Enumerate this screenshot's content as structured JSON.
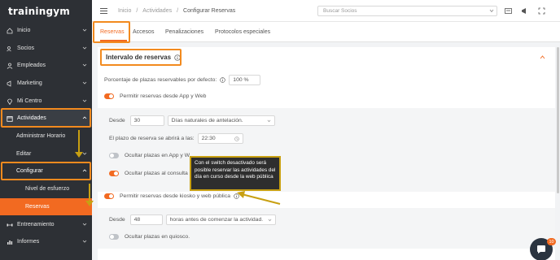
{
  "app": {
    "logo": "trainingym"
  },
  "sidebar": {
    "items": [
      {
        "label": "Inicio"
      },
      {
        "label": "Socios"
      },
      {
        "label": "Empleados"
      },
      {
        "label": "Marketing"
      },
      {
        "label": "Mi Centro"
      },
      {
        "label": "Actividades"
      },
      {
        "label": "Administrar Horario"
      },
      {
        "label": "Editar"
      },
      {
        "label": "Configurar"
      },
      {
        "label": "Nivel de esfuerzo"
      },
      {
        "label": "Reservas"
      },
      {
        "label": "Entrenamiento"
      },
      {
        "label": "Informes"
      }
    ]
  },
  "header": {
    "breadcrumb": [
      "Inicio",
      "/",
      "Actividades",
      "/",
      "Configurar Reservas"
    ],
    "search_placeholder": "Buscar Socios"
  },
  "tabs": [
    {
      "label": "Reservas"
    },
    {
      "label": "Accesos"
    },
    {
      "label": "Penalizaciones"
    },
    {
      "label": "Protocolos especiales"
    }
  ],
  "section": {
    "title": "Intervalo de reservas",
    "pct_label": "Porcentaje de plazas reservables por defecto:",
    "pct_value": "100 %",
    "app_web_label": "Permitir reservas desde App y Web",
    "desde_label": "Desde",
    "desde_value": "30",
    "desde_select": "Días naturales de antelación.",
    "plazo_label": "El plazo de reserva se abrirá a las:",
    "plazo_value": "22:30",
    "ocultar_app_label": "Ocultar plazas en App y W",
    "ocultar_consulta_label": "Ocultar plazas al consulta",
    "kiosko_label": "Permitir reservas desde kiosko y web pública",
    "desde2_label": "Desde",
    "desde2_value": "48",
    "desde2_select": "horas antes de comenzar la actividad.",
    "ocultar_quiosco_label": "Ocultar plazas en quiosco.",
    "tooltip": "Con el switch desactivado será posible reservar las actividades del día en curso desde la web pública"
  },
  "chat": {
    "badge": "10"
  },
  "colors": {
    "accent": "#f26a21",
    "sidebar": "#2d3035",
    "highlight": "#f28a1e",
    "annotation": "#c8a012"
  }
}
